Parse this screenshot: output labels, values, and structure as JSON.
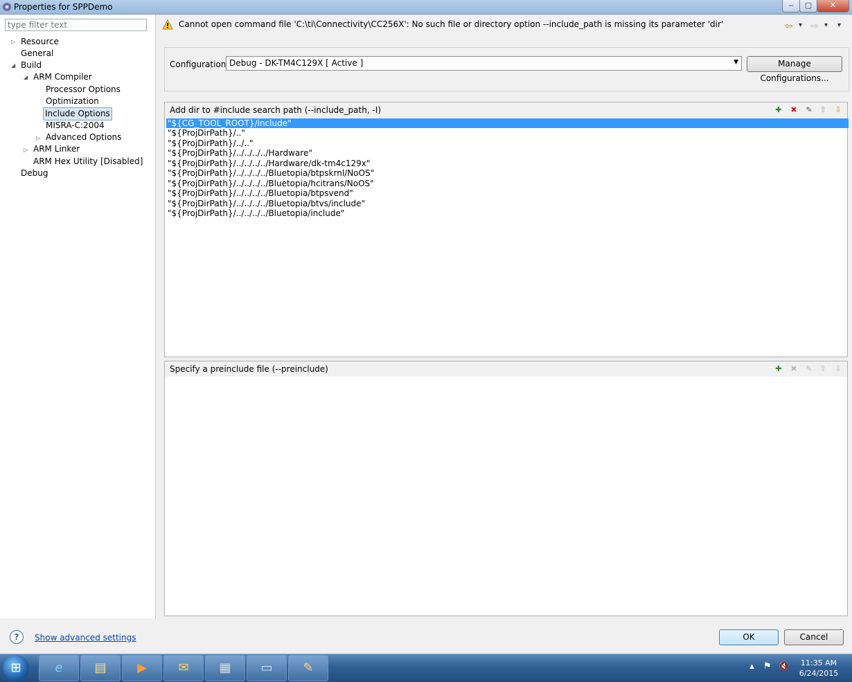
{
  "window": {
    "title": "Properties for SPPDemo",
    "controls": {
      "minimize": "‒",
      "maximize": "▢",
      "close": "✕"
    }
  },
  "filter": {
    "placeholder": "type filter text"
  },
  "tree": [
    {
      "label": "Resource",
      "twisty": "▷"
    },
    {
      "label": "General",
      "twisty": ""
    },
    {
      "label": "Build",
      "twisty": "◢"
    },
    {
      "label": "ARM Compiler",
      "twisty": "◢"
    },
    {
      "label": "Processor Options",
      "twisty": ""
    },
    {
      "label": "Optimization",
      "twisty": ""
    },
    {
      "label": "Include Options",
      "twisty": "",
      "selected": true
    },
    {
      "label": "MISRA-C:2004",
      "twisty": ""
    },
    {
      "label": "Advanced Options",
      "twisty": "▷"
    },
    {
      "label": "ARM Linker",
      "twisty": "▷"
    },
    {
      "label": "ARM Hex Utility  [Disabled]",
      "twisty": ""
    },
    {
      "label": "Debug",
      "twisty": ""
    }
  ],
  "warning": {
    "icon": "warning-icon",
    "text": "Cannot open command file 'C:\\ti\\Connectivity\\CC256X': No such file or directory option --include_path is missing its parameter 'dir'"
  },
  "nav": {
    "back": "⇦",
    "forward": "⇨",
    "menu": "▾"
  },
  "configuration": {
    "label": "Configuration:",
    "value": "Debug - DK-TM4C129X  [ Active ]",
    "manage_label": "Manage Configurations..."
  },
  "include_panel": {
    "header": "Add dir to #include search path (--include_path, -I)",
    "tools": {
      "add": "✚",
      "delete": "✖",
      "edit": "✎",
      "up": "⇧",
      "down": "⇩"
    },
    "items": [
      "\"${CG_TOOL_ROOT}/include\"",
      "\"${ProjDirPath}/..\"",
      "\"${ProjDirPath}/../..\"",
      "\"${ProjDirPath}/../../../../Hardware\"",
      "\"${ProjDirPath}/../../../../Hardware/dk-tm4c129x\"",
      "\"${ProjDirPath}/../../../../Bluetopia/btpskrnl/NoOS\"",
      "\"${ProjDirPath}/../../../../Bluetopia/hcitrans/NoOS\"",
      "\"${ProjDirPath}/../../../../Bluetopia/btpsvend\"",
      "\"${ProjDirPath}/../../../../Bluetopia/btvs/include\"",
      "\"${ProjDirPath}/../../../../Bluetopia/include\""
    ]
  },
  "preinclude_panel": {
    "header": "Specify a preinclude file (--preinclude)",
    "tools": {
      "add": "✚",
      "delete": "✖",
      "edit": "✎",
      "up": "⇧",
      "down": "⇩"
    }
  },
  "footer": {
    "help": "?",
    "advanced_link": "Show advanced settings",
    "ok_label": "OK",
    "cancel_label": "Cancel"
  },
  "taskbar": {
    "start": "⊞",
    "apps": [
      "e",
      "▤",
      "▶",
      "✉",
      "▦",
      "▭",
      "✎"
    ],
    "tray": {
      "up": "▲",
      "flag": "⚑",
      "volume": "🔇"
    },
    "time": "11:35 AM",
    "date": "6/24/2015"
  }
}
